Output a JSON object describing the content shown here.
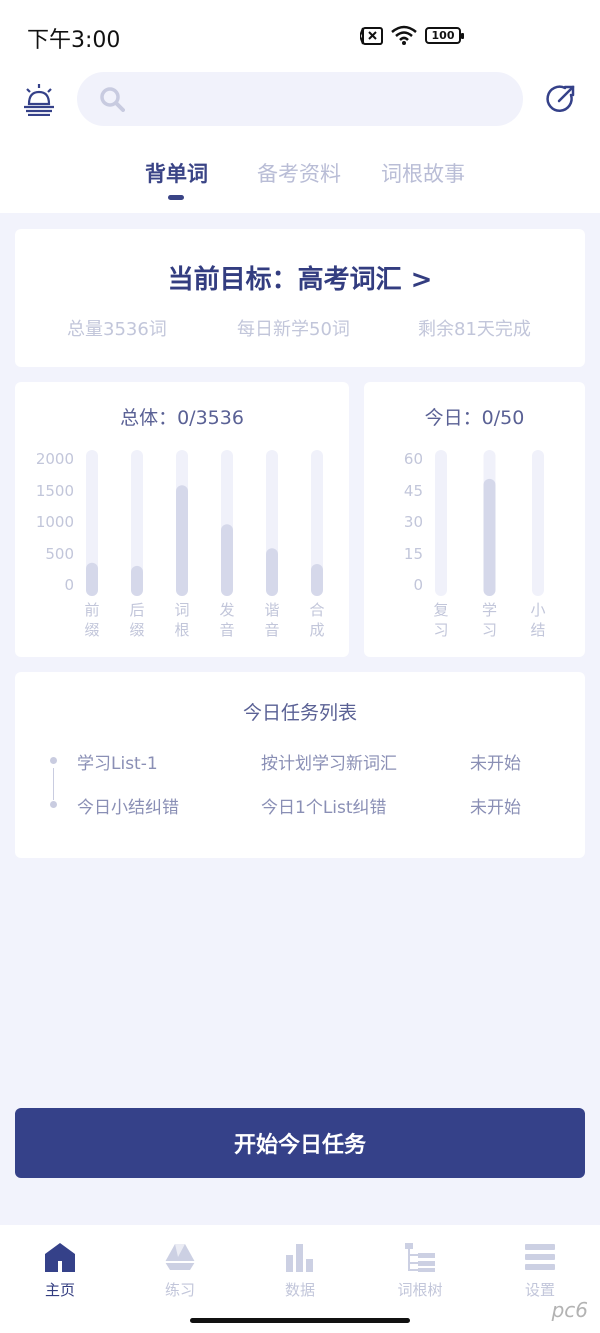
{
  "status_bar": {
    "time": "下午3:00",
    "battery": "100"
  },
  "search": {
    "placeholder": ""
  },
  "tabs": [
    {
      "label": "背单词",
      "active": true
    },
    {
      "label": "备考资料",
      "active": false
    },
    {
      "label": "词根故事",
      "active": false
    }
  ],
  "goal": {
    "title": "当前目标：高考词汇 >",
    "total": "总量3536词",
    "daily": "每日新学50词",
    "remaining": "剩余81天完成"
  },
  "overall": {
    "heading": "总体：0/3536",
    "y_ticks": [
      "2000",
      "1500",
      "1000",
      "500",
      "0"
    ],
    "x_labels": [
      "前缀",
      "后缀",
      "词根",
      "发音",
      "谐音",
      "合成"
    ]
  },
  "today": {
    "heading": "今日：0/50",
    "y_ticks": [
      "60",
      "45",
      "30",
      "15",
      "0"
    ],
    "x_labels": [
      "复习",
      "学习",
      "小结"
    ]
  },
  "chart_data": [
    {
      "type": "bar",
      "title": "总体：0/3536",
      "categories": [
        "前缀",
        "后缀",
        "词根",
        "发音",
        "谐音",
        "合成"
      ],
      "values": [
        370,
        320,
        1600,
        980,
        600,
        350
      ],
      "ylim": [
        0,
        2000
      ],
      "y_ticks": [
        0,
        500,
        1000,
        1500,
        2000
      ],
      "grid": false
    },
    {
      "type": "bar",
      "title": "今日：0/50",
      "categories": [
        "复习",
        "学习",
        "小结"
      ],
      "values": [
        0,
        51,
        0
      ],
      "ylim": [
        0,
        60
      ],
      "y_ticks": [
        0,
        15,
        30,
        45,
        60
      ],
      "grid": false
    }
  ],
  "tasks": {
    "title": "今日任务列表",
    "items": [
      {
        "name": "学习List-1",
        "desc": "按计划学习新词汇",
        "status": "未开始"
      },
      {
        "name": "今日小结纠错",
        "desc": "今日1个List纠错",
        "status": "未开始"
      }
    ]
  },
  "start_button": {
    "label": "开始今日任务"
  },
  "nav": [
    {
      "label": "主页",
      "icon": "home-icon",
      "active": true
    },
    {
      "label": "练习",
      "icon": "practice-icon",
      "active": false
    },
    {
      "label": "数据",
      "icon": "data-icon",
      "active": false
    },
    {
      "label": "词根树",
      "icon": "root-tree-icon",
      "active": false
    },
    {
      "label": "设置",
      "icon": "settings-icon",
      "active": false
    }
  ],
  "colors": {
    "primary": "#354189",
    "bar_track": "#f0f1fa",
    "bar_fill": "#d5d8ea",
    "muted_text": "#c2c6da"
  },
  "watermark": "pc6"
}
